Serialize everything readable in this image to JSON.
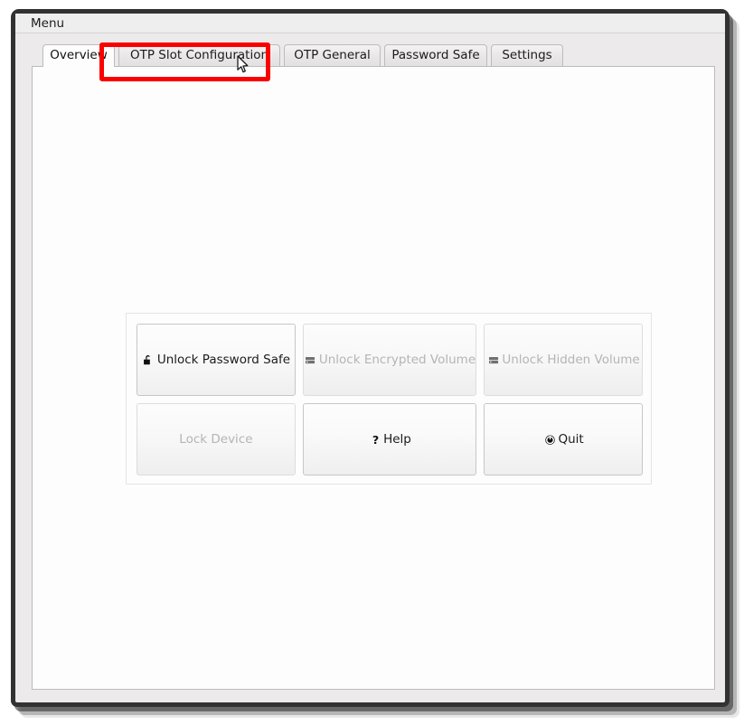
{
  "window": {
    "menu_bar": {
      "items": [
        {
          "label": "Menu"
        }
      ]
    },
    "tabs": [
      {
        "label": "Overview",
        "selected": true
      },
      {
        "label": "OTP Slot Configuration",
        "selected": false,
        "highlighted": true
      },
      {
        "label": "OTP General",
        "selected": false
      },
      {
        "label": "Password Safe",
        "selected": false
      },
      {
        "label": "Settings",
        "selected": false
      }
    ]
  },
  "main": {
    "buttons": [
      {
        "label": "Unlock Password Safe",
        "icon": "open-padlock-icon",
        "enabled": true
      },
      {
        "label": "Unlock Encrypted Volume",
        "icon": "hard-drive-icon",
        "enabled": false
      },
      {
        "label": "Unlock Hidden Volume",
        "icon": "hard-drive-icon",
        "enabled": false
      },
      {
        "label": "Lock Device",
        "icon": "none",
        "enabled": false
      },
      {
        "label": "Help",
        "icon": "question-mark-icon",
        "enabled": true
      },
      {
        "label": "Quit",
        "icon": "power-icon",
        "enabled": true
      }
    ]
  },
  "annotation": {
    "highlight_color": "#fb0000",
    "highlight_target": "OTP Slot Configuration",
    "cursor": "arrow-pointer"
  },
  "colors": {
    "window_border": "#333232",
    "window_background": "#eceaea",
    "panel_background": "#fdfdfd",
    "tab_background": "#e8e6e6",
    "disabled_text": "#b6b4b4",
    "icon_grey": "#707070"
  }
}
